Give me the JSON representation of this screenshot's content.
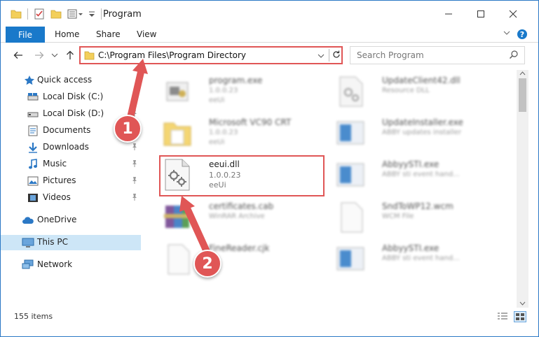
{
  "window": {
    "title": "Program",
    "controls": [
      "minimize",
      "maximize",
      "close"
    ]
  },
  "ribbon": {
    "file_label": "File",
    "home_label": "Home",
    "share_label": "Share",
    "view_label": "View"
  },
  "address_bar": {
    "path": "C:\\Program Files\\Program Directory"
  },
  "search": {
    "placeholder": "Search Program"
  },
  "sidebar": {
    "items": [
      {
        "label": "Quick access",
        "icon": "star-icon"
      },
      {
        "label": "Local Disk (C:)",
        "icon": "drive-icon"
      },
      {
        "label": "Local Disk (D:)",
        "icon": "drive-icon"
      },
      {
        "label": "Documents",
        "icon": "documents-icon"
      },
      {
        "label": "Downloads",
        "icon": "downloads-icon"
      },
      {
        "label": "Music",
        "icon": "music-icon"
      },
      {
        "label": "Pictures",
        "icon": "pictures-icon"
      },
      {
        "label": "Videos",
        "icon": "videos-icon"
      },
      {
        "label": "OneDrive",
        "icon": "cloud-icon"
      },
      {
        "label": "This PC",
        "icon": "computer-icon"
      },
      {
        "label": "Network",
        "icon": "network-icon"
      }
    ]
  },
  "files": [
    {
      "name": "program.exe",
      "line1": "1.0.0.23",
      "line2": "eeUi"
    },
    {
      "name": "UpdateClient42.dll",
      "line1": "Resource DLL",
      "line2": ""
    },
    {
      "name": "Microsoft VC90 CRT",
      "line1": "1.0.0.23",
      "line2": "eeUi"
    },
    {
      "name": "UpdateInstaller.exe",
      "line1": "ABBY updates installer",
      "line2": ""
    },
    {
      "name": "eeui.dll",
      "line1": "1.0.0.23",
      "line2": "eeUi"
    },
    {
      "name": "AbbyySTI.exe",
      "line1": "ABBY sti event hand...",
      "line2": ""
    },
    {
      "name": "certificates.cab",
      "line1": "WinRAR Archive",
      "line2": ""
    },
    {
      "name": "SndToWP12.wcm",
      "line1": "WCM File",
      "line2": ""
    },
    {
      "name": "FineReader.cjk",
      "line1": "",
      "line2": ""
    },
    {
      "name": "AbbyySTI.exe",
      "line1": "ABBY sti event hand...",
      "line2": ""
    }
  ],
  "status": {
    "item_count": "155 items"
  },
  "annotations": {
    "step1": "1",
    "step2": "2"
  },
  "colors": {
    "accent": "#1979ca",
    "highlight": "#e05656",
    "selected": "#cde6f7"
  }
}
